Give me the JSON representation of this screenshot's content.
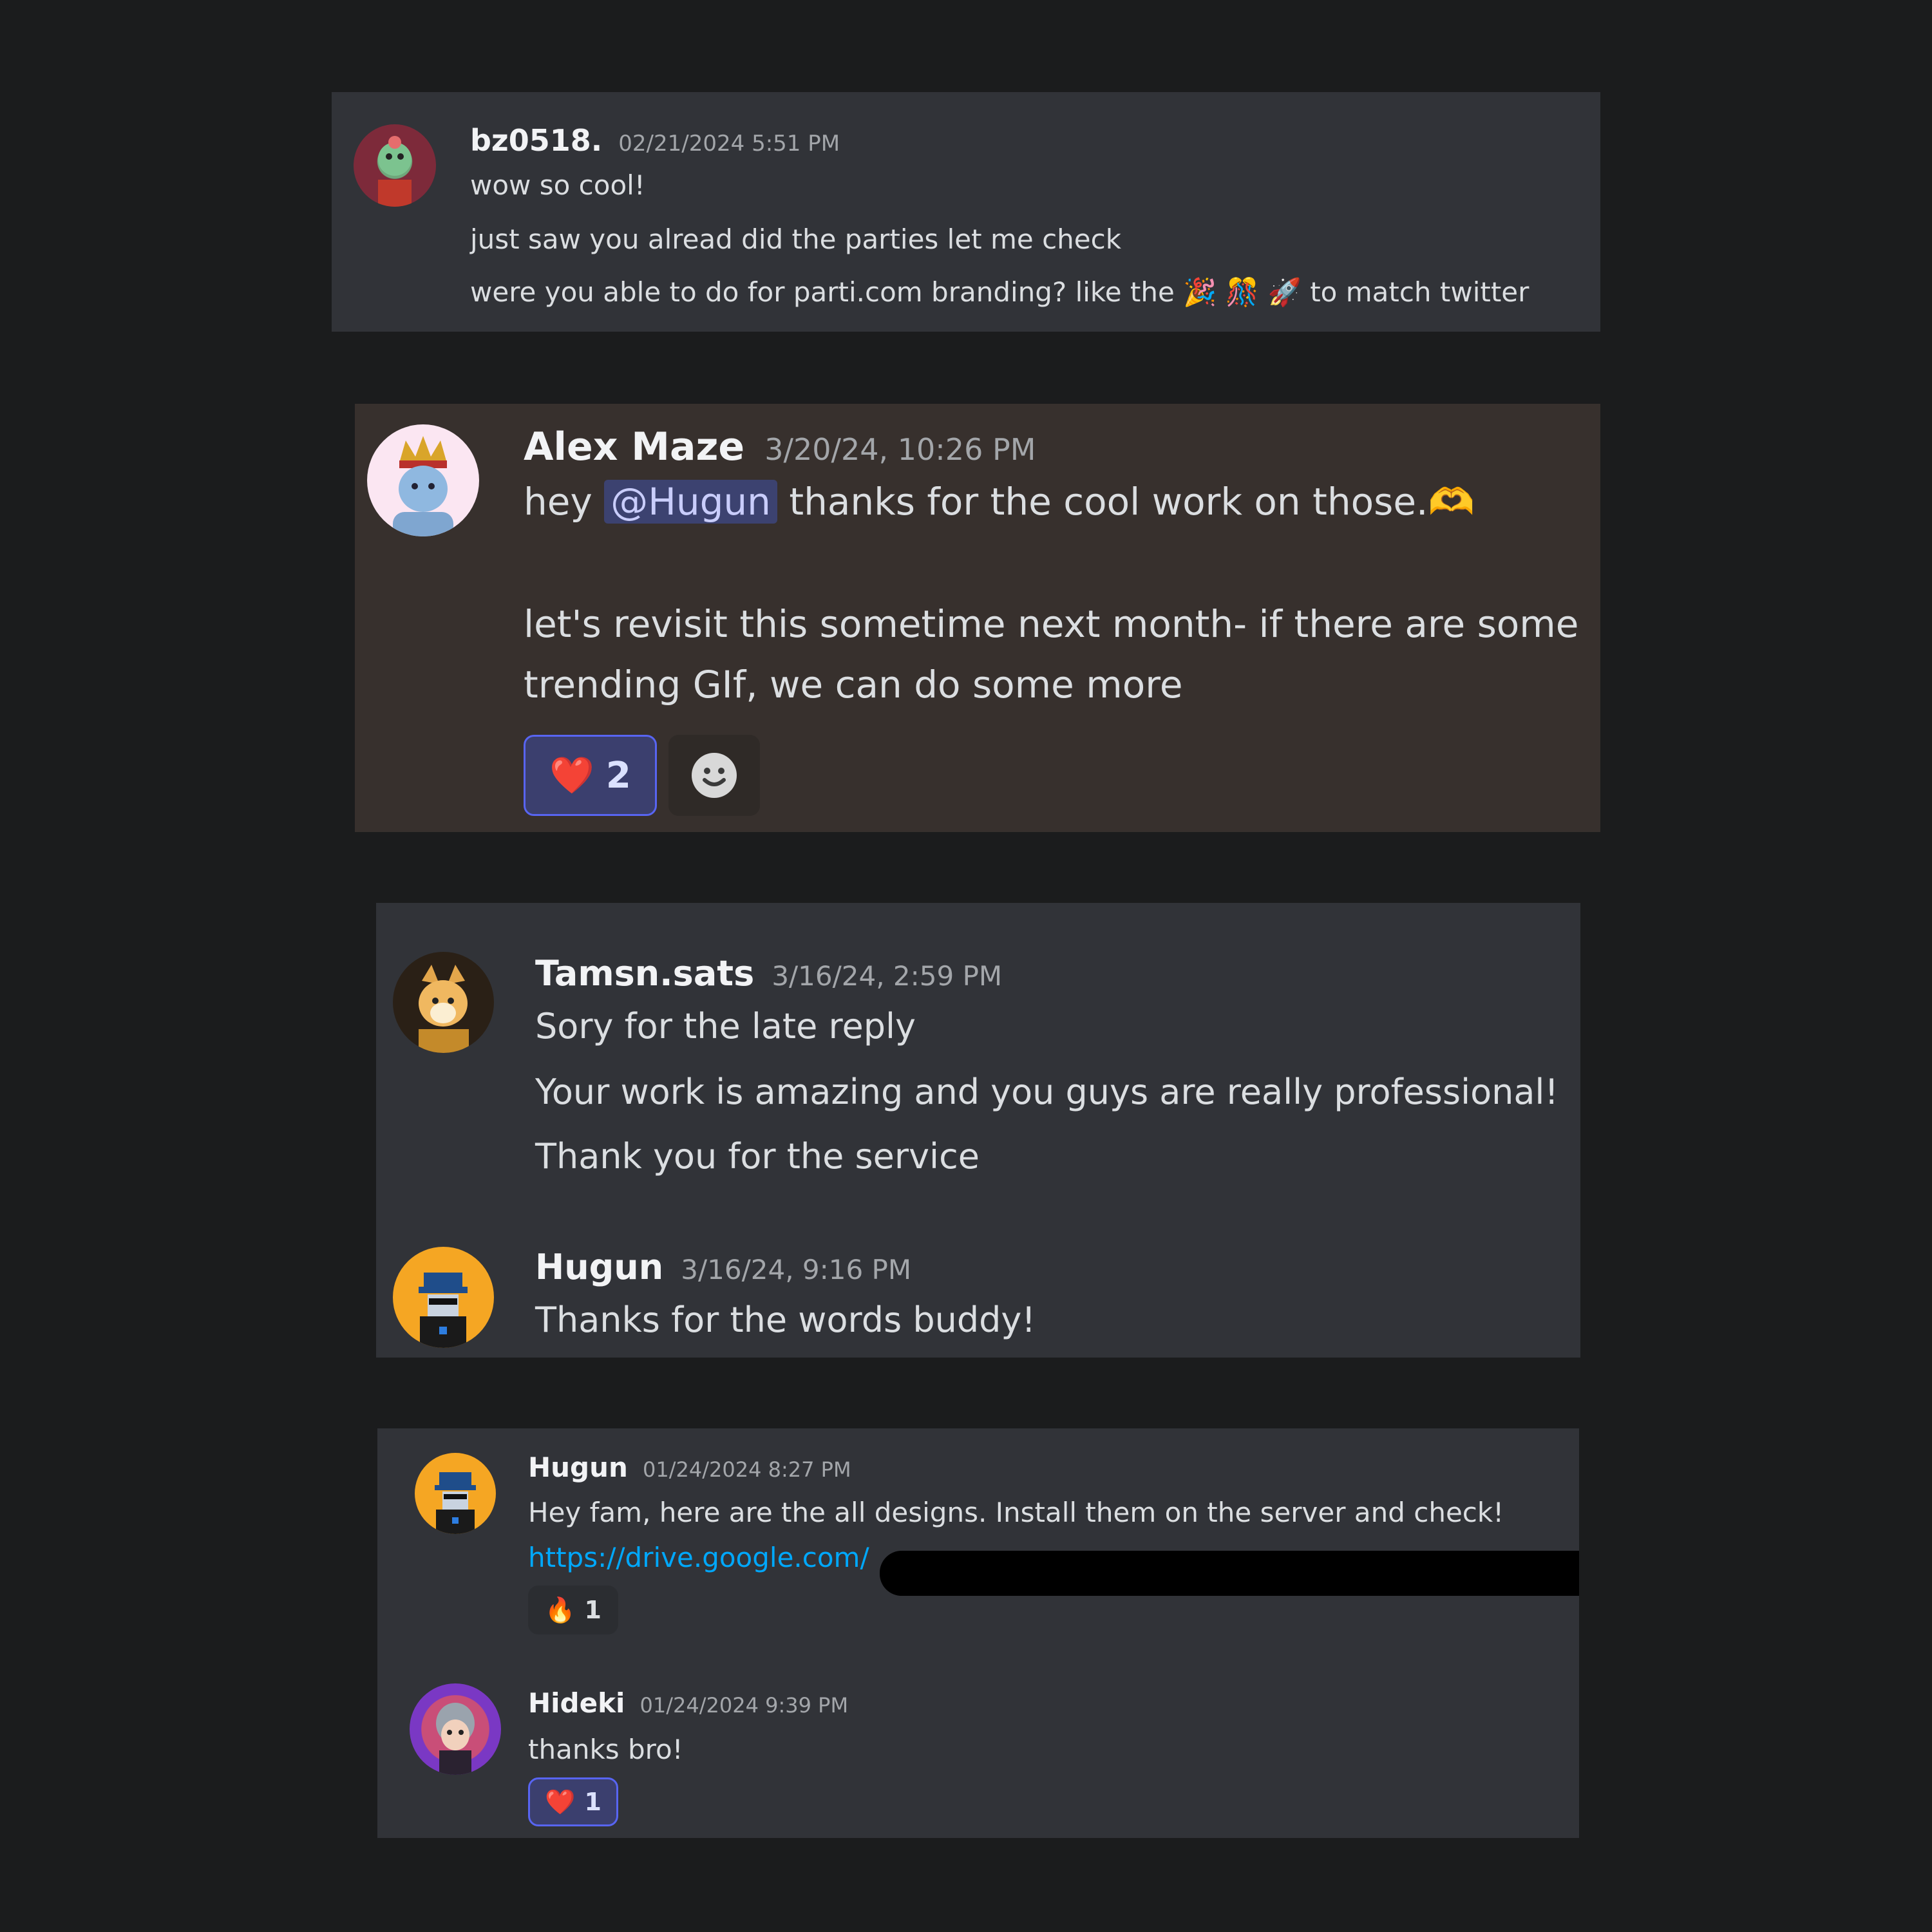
{
  "messages": [
    {
      "author": "bz0518.",
      "timestamp": "02/21/2024 5:51 PM",
      "lines": [
        "wow so cool!",
        "just saw you alread did the parties let me check",
        "were you able to do for parti.com branding? like the",
        "to match twitter"
      ],
      "emojis": [
        "🎉",
        "🎊",
        "🚀"
      ]
    },
    {
      "author": "Alex Maze",
      "timestamp": "3/20/24, 10:26 PM",
      "line1_prefix": "hey",
      "mention": "@Hugun",
      "line1_suffix": "thanks for the cool work on those.",
      "heart_hands_emoji": "🫶",
      "lines": [
        "let's revisit this sometime next month- if there are some",
        "trending GIf, we can do some more"
      ],
      "reaction": {
        "emoji": "❤️",
        "count": "2"
      },
      "add_reaction_icon": "smile-icon"
    },
    {
      "author": "Tamsn.sats",
      "timestamp": "3/16/24, 2:59 PM",
      "lines": [
        "Sory for the late reply",
        "Your work is amazing and you guys are really professional!",
        "Thank you for the service"
      ]
    },
    {
      "author": "Hugun",
      "timestamp": "3/16/24, 9:16 PM",
      "lines": [
        "Thanks for the words buddy!"
      ]
    },
    {
      "author": "Hugun",
      "timestamp": "01/24/2024 8:27 PM",
      "lines": [
        "Hey fam, here are the all designs. Install them on the server and check!"
      ],
      "link": "https://drive.google.com/",
      "reaction": {
        "emoji": "🔥",
        "count": "1"
      }
    },
    {
      "author": "Hideki",
      "timestamp": "01/24/2024 9:39 PM",
      "lines": [
        "thanks bro!"
      ],
      "reaction": {
        "emoji": "❤️",
        "count": "1"
      }
    }
  ],
  "colors": {
    "page_bg": "#1b1c1d",
    "panel_bg": "#313338",
    "panel_highlight_bg": "#37302d",
    "link": "#00a8fc",
    "reaction_active_border": "#5865f2"
  }
}
